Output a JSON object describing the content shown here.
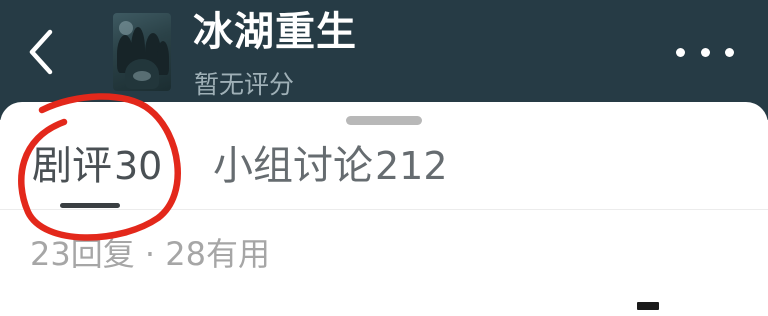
{
  "header": {
    "title": "冰湖重生",
    "rating": "暂无评分",
    "back_icon": "chevron-left-icon",
    "more_icon": "more-horizontal-icon",
    "background": "#263b45"
  },
  "tabs": [
    {
      "label": "剧评",
      "count": "30",
      "active": true
    },
    {
      "label": "小组讨论",
      "count": "212",
      "active": false
    }
  ],
  "review_stats": "23回复 · 28有用",
  "annotation": {
    "shape": "red-circle",
    "color": "#e3281b"
  }
}
